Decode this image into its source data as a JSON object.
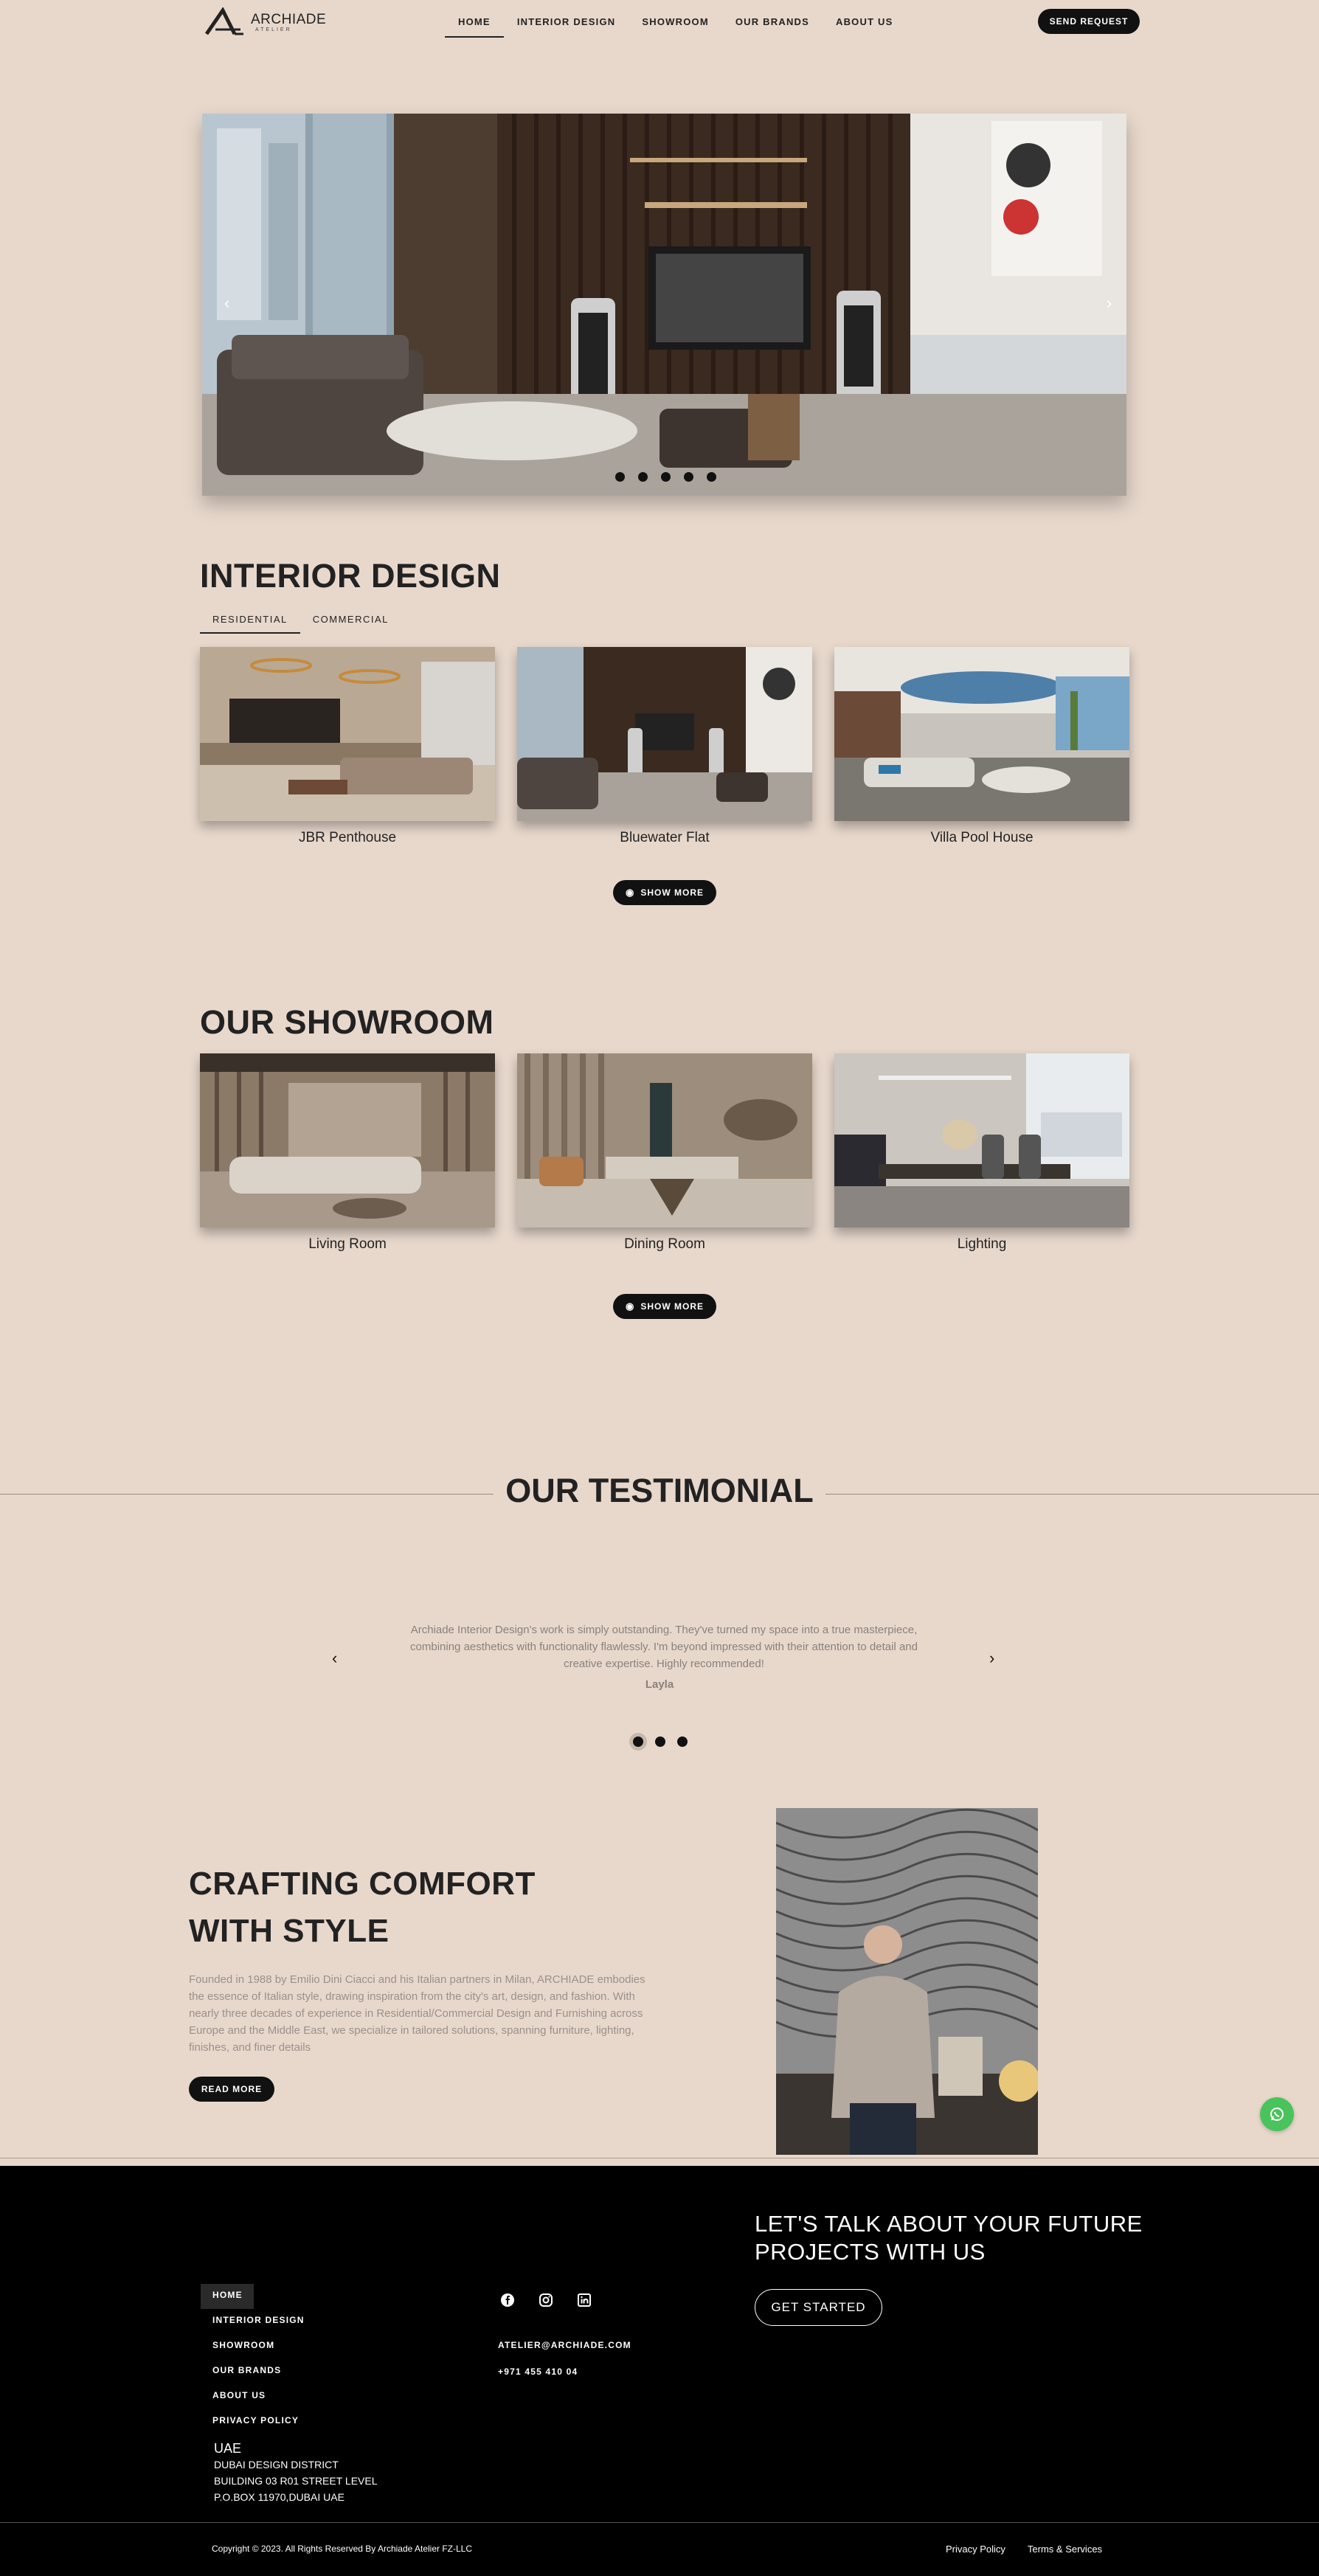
{
  "brand": {
    "name": "ARCHIADE",
    "sub": "ATELIER"
  },
  "nav": [
    "HOME",
    "INTERIOR DESIGN",
    "SHOWROOM",
    "OUR BRANDS",
    "ABOUT US"
  ],
  "header_button": "SEND REQUEST",
  "hero": {
    "slide_count": 5,
    "active_slide": 1
  },
  "interior": {
    "title": "INTERIOR DESIGN",
    "tabs": [
      "RESIDENTIAL",
      "COMMERCIAL"
    ],
    "cards": [
      "JBR Penthouse",
      "Bluewater Flat",
      "Villa Pool House"
    ],
    "button": "SHOW MORE"
  },
  "showroom": {
    "title": "OUR SHOWROOM",
    "cards": [
      "Living Room",
      "Dining Room",
      "Lighting"
    ],
    "button": "SHOW MORE"
  },
  "testimonial": {
    "title": "OUR TESTIMONIAL",
    "quote": "Archiade Interior Design's work is simply outstanding. They've turned my space into a true masterpiece, combining aesthetics with functionality flawlessly. I'm beyond impressed with their attention to detail and creative expertise. Highly recommended!",
    "author": "Layla",
    "dots": 3,
    "active_dot": 1
  },
  "about": {
    "title_lines": [
      "CRAFTING COMFORT",
      "WITH STYLE"
    ],
    "text": "Founded in 1988 by Emilio Dini Ciacci and his Italian partners in Milan, ARCHIADE embodies the essence of Italian style, drawing inspiration from the city's art, design, and fashion. With nearly three decades of experience in Residential/Commercial Design and Furnishing across Europe and the Middle East, we specialize in tailored solutions, spanning furniture, lighting, finishes, and finer details",
    "button": "READ MORE"
  },
  "footer": {
    "nav": [
      "HOME",
      "INTERIOR DESIGN",
      "SHOWROOM",
      "OUR BRANDS",
      "ABOUT US",
      "PRIVACY POLICY"
    ],
    "address": {
      "country": "UAE",
      "lines": [
        "DUBAI DESIGN DISTRICT",
        "BUILDING 03 R01 STREET LEVEL",
        "P.O.BOX 11970,DUBAI UAE"
      ]
    },
    "email": "ATELIER@ARCHIADE.COM",
    "phone": "+971 455 410 04",
    "cta_lines": [
      "LET'S TALK ABOUT YOUR FUTURE",
      "PROJECTS WITH US"
    ],
    "cta_button": "GET STARTED",
    "copyright": "Copyright © 2023. All Rights Reserved By Archiade Atelier FZ-LLC",
    "links": [
      "Privacy Policy",
      "Terms & Services"
    ]
  },
  "colors": {
    "background": "#e8d8cc",
    "dark": "#111111",
    "whatsapp": "#4ac35c"
  }
}
